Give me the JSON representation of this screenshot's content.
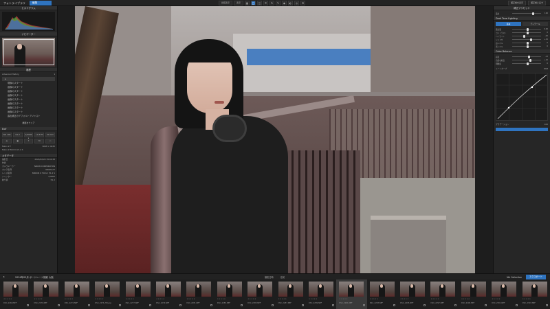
{
  "app": {
    "title": "フォトライブラリ",
    "edit_tab": "編集"
  },
  "toolbar": {
    "compare_label": "比較表示",
    "display_label": "表示",
    "icons": [
      "grid-icon",
      "single-view-icon",
      "compare-icon",
      "crop-icon",
      "rotate-icon",
      "brush-icon",
      "spot-icon",
      "gradient-icon",
      "eye-icon",
      "settings-icon"
    ],
    "right_btn_1": "補正前を表示",
    "right_btn_2": "補正前に戻す"
  },
  "left_panel": {
    "histogram_title": "ヒストグラム",
    "navigator_title": "ナビゲーター",
    "history_title": "履歴",
    "history_group": "Advanced History",
    "history_items": [
      "現像のスタート",
      "画像のスタート",
      "画像のスタート",
      "画像のスタート",
      "画像のスタート",
      "画像のスタート",
      "画像のスタート",
      "画像のスタート",
      "露出補正のデフォルトアジャスト"
    ],
    "history_clear": "履歴をクリア",
    "exif_title": "Exif",
    "exif_buttons": [
      "ISO 100",
      "f/1.2",
      "1/4000 s",
      "+0.3 EV",
      "50 mm"
    ],
    "camera": "Nikon Z f",
    "lens": "Nikon Z 50mm f/1.2 S",
    "resolution": "6048 × 4032",
    "metadata_title": "メタデータ",
    "metadata_rows": [
      [
        "撮影日",
        "2024/02/24 15:04:38"
      ],
      [
        "作者",
        ""
      ],
      [
        "カメラメーカー",
        "NIKON CORPORATION"
      ],
      [
        "カメラ名称",
        "NIKON Z f"
      ],
      [
        "レンズ名称",
        "NIKKOR Z 50mm f/1.2 S"
      ],
      [
        "シャッター",
        "1/4000"
      ],
      [
        "絞り値",
        "f/1.2"
      ]
    ]
  },
  "right_panel": {
    "top_label": "補正プリセット",
    "tab_basic": "基本",
    "tab_detail": "ディテール",
    "exposure_label": "露出",
    "section_light": "Dark Tone Lighting",
    "section_color": "Color Balance",
    "sliders": [
      {
        "label": "露出量",
        "value": "0.00",
        "pos": 0.5
      },
      {
        "label": "コントラスト",
        "value": "0",
        "pos": 0.5
      },
      {
        "label": "ハイライト",
        "value": "-20",
        "pos": 0.38
      },
      {
        "label": "シャドウ",
        "value": "+15",
        "pos": 0.62
      },
      {
        "label": "白レベル",
        "value": "0",
        "pos": 0.5
      },
      {
        "label": "黒レベル",
        "value": "0",
        "pos": 0.5
      },
      {
        "label": "彩度",
        "value": "+5",
        "pos": 0.55
      },
      {
        "label": "自然な彩度",
        "value": "+10",
        "pos": 0.6
      },
      {
        "label": "明瞭度",
        "value": "0",
        "pos": 0.5
      }
    ],
    "curve_title": "トーンカーブ",
    "curve_channel": "RGB",
    "bottom_label": "グラデーション",
    "bottom_value": "100"
  },
  "film": {
    "folder_path": "2024年02月 ポートレート撮影 大阪",
    "mid_1": "撮影日時",
    "mid_2": "名前",
    "collection": "Nik Collection",
    "export": "エクスポート",
    "items": [
      "DSC_2268.NEF",
      "DSC_2270.NEF",
      "DSC_2272.NEF",
      "DSC_2276_HQ.jpg",
      "DSC_2277.NEF",
      "DSC_2279.NEF",
      "DSC_2281.NEF",
      "DSC_2283.NEF",
      "DSC_2285.NEF",
      "DSC_2287.NEF",
      "DSC_2289.NEF",
      "DSC_2291.NEF",
      "DSC_2293.NEF",
      "DSC_2295.NEF",
      "DSC_2297.NEF",
      "DSC_2299.NEF",
      "DSC_2301.NEF",
      "DSC_2303.NEF"
    ],
    "selected_index": 11,
    "stars": "★★★★★"
  }
}
